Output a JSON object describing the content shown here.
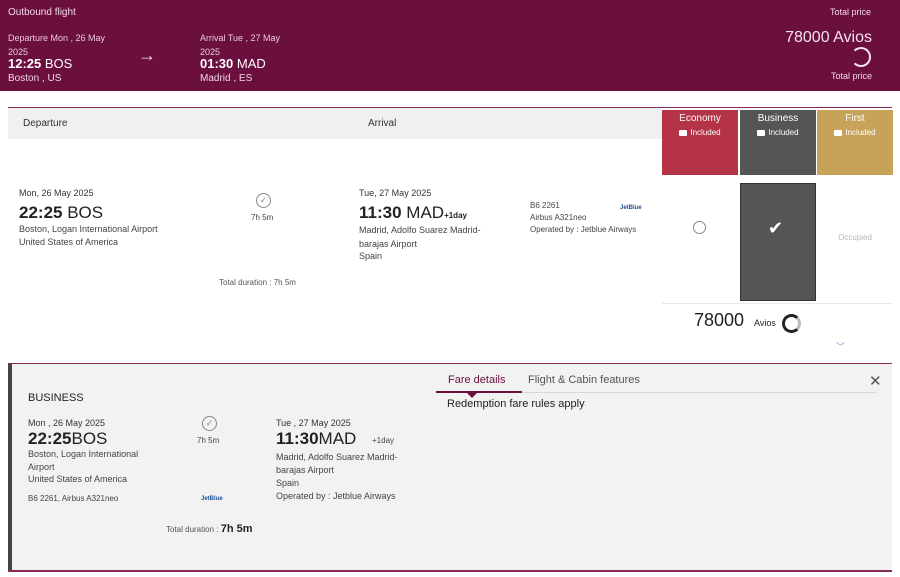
{
  "header": {
    "title": "Outbound flight",
    "total_price_top": "Total price",
    "price": "78000 Avios",
    "total_price_bottom": "Total price",
    "departure": {
      "date": "Departure Mon , 26 May 2025",
      "time": "12:25",
      "code": "BOS",
      "city": "Boston , US"
    },
    "arrival": {
      "date": "Arrival Tue , 27 May 2025",
      "time": "01:30",
      "code": "MAD",
      "city": "Madrid , ES"
    },
    "arrow_icon": "→"
  },
  "columns": {
    "departure": "Departure",
    "arrival": "Arrival"
  },
  "cabins": [
    {
      "name": "Economy",
      "included": "Included",
      "color": "#b43346"
    },
    {
      "name": "Business",
      "included": "Included",
      "color": "#555555"
    },
    {
      "name": "First",
      "included": "Included",
      "color": "#c7a35a"
    }
  ],
  "selection": {
    "first_status": "Occupied",
    "selected_cabin": "Business"
  },
  "flight": {
    "departure": {
      "date": "Mon, 26 May 2025",
      "time": "22:25",
      "code": "BOS",
      "airport": "Boston, Logan International Airport",
      "country": "United States of America"
    },
    "duration": "7h 5m",
    "arrival": {
      "date": "Tue, 27 May 2025",
      "time": "11:30",
      "code": "MAD",
      "plus_day": "+1day",
      "airport": "Madrid, Adolfo Suarez Madrid-barajas Airport",
      "country": "Spain"
    },
    "flight_number": "B6 2261",
    "aircraft": "Airbus A321neo",
    "operated": "Operated by : Jetblue Airways",
    "airline_logo": "JetBlue",
    "total_duration": "Total duration : 7h 5m"
  },
  "avios": {
    "value": "78000",
    "label": "Avios"
  },
  "details": {
    "cabin": "BUSINESS",
    "departure": {
      "date": "Mon , 26 May 2025",
      "time": "22:25",
      "code": "BOS",
      "airport": "Boston, Logan International Airport",
      "country": "United States of America"
    },
    "duration": "7h 5m",
    "arrival": {
      "date": "Tue , 27 May 2025",
      "time": "11:30",
      "code": "MAD",
      "plus_day": "+1day",
      "airport": "Madrid, Adolfo Suarez Madrid-barajas Airport",
      "country": "Spain",
      "operated": "Operated by : Jetblue Airways"
    },
    "flight": "B6 2261, Airbus A321neo",
    "airline_logo": "JetBlue",
    "total_duration_label": "Total duration :",
    "total_duration_value": "7h 5m",
    "tabs": {
      "fare": "Fare details",
      "cabin": "Flight & Cabin features"
    },
    "fare_text": "Redemption fare rules apply",
    "close_icon": "✕"
  },
  "colors": {
    "brand": "#6b0f3f",
    "economy": "#b43346",
    "business": "#555555",
    "first": "#c7a35a"
  }
}
